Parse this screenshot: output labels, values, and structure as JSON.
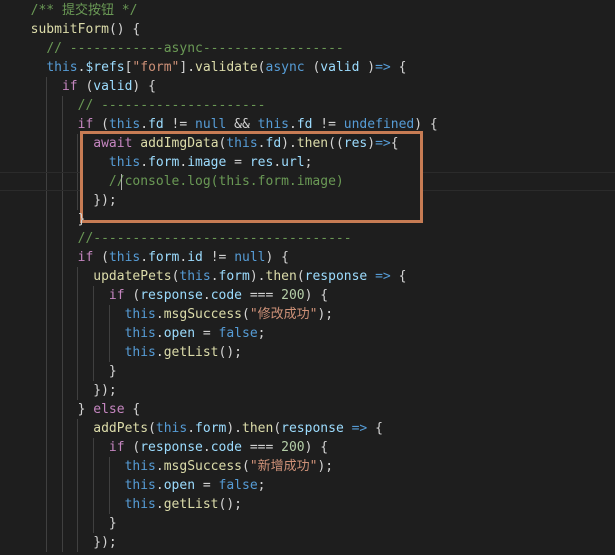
{
  "editor": {
    "lines": [
      [
        "  ",
        [
          "cm",
          "/** 提交按钮 */"
        ]
      ],
      [
        "  ",
        [
          "fn",
          "submitForm"
        ],
        [
          "pu",
          "() {"
        ]
      ],
      [
        "    ",
        [
          "cm",
          "// ------------async------------------"
        ]
      ],
      [
        "    ",
        [
          "sk",
          "this"
        ],
        [
          "pu",
          "."
        ],
        [
          "vr",
          "$refs"
        ],
        [
          "pu",
          "["
        ],
        [
          "st",
          "\"form\""
        ],
        [
          "pu",
          "]."
        ],
        [
          "fn",
          "validate"
        ],
        [
          "pu",
          "("
        ],
        [
          "sk",
          "async"
        ],
        [
          "pu",
          " ("
        ],
        [
          "vr",
          "valid"
        ],
        [
          "pu",
          " )"
        ],
        [
          "sk",
          "=>"
        ],
        [
          "pu",
          " {"
        ]
      ],
      [
        "      ",
        [
          "kw",
          "if"
        ],
        [
          "pu",
          " ("
        ],
        [
          "vr",
          "valid"
        ],
        [
          "pu",
          ") {"
        ]
      ],
      [
        "        ",
        [
          "cm",
          "// ---------------------"
        ]
      ],
      [
        "        ",
        [
          "kw",
          "if"
        ],
        [
          "pu",
          " ("
        ],
        [
          "sk",
          "this"
        ],
        [
          "pu",
          "."
        ],
        [
          "vr",
          "fd"
        ],
        [
          "pu",
          " != "
        ],
        [
          "sk",
          "null"
        ],
        [
          "pu",
          " && "
        ],
        [
          "sk",
          "this"
        ],
        [
          "pu",
          "."
        ],
        [
          "vr",
          "fd"
        ],
        [
          "pu",
          " != "
        ],
        [
          "sk",
          "undefined"
        ],
        [
          "pu",
          ") {"
        ]
      ],
      [
        "          ",
        [
          "kw",
          "await"
        ],
        [
          "pu",
          " "
        ],
        [
          "fn",
          "addImgData"
        ],
        [
          "pu",
          "("
        ],
        [
          "sk",
          "this"
        ],
        [
          "pu",
          "."
        ],
        [
          "vr",
          "fd"
        ],
        [
          "pu",
          ")."
        ],
        [
          "fn",
          "then"
        ],
        [
          "pu",
          "(("
        ],
        [
          "vr",
          "res"
        ],
        [
          "pu",
          ")"
        ],
        [
          "sk",
          "=>"
        ],
        [
          "pu",
          "{"
        ]
      ],
      [
        "            ",
        [
          "sk",
          "this"
        ],
        [
          "pu",
          "."
        ],
        [
          "vr",
          "form"
        ],
        [
          "pu",
          "."
        ],
        [
          "vr",
          "image"
        ],
        [
          "pu",
          " = "
        ],
        [
          "vr",
          "res"
        ],
        [
          "pu",
          "."
        ],
        [
          "vr",
          "url"
        ],
        [
          "pu",
          ";"
        ]
      ],
      [
        "            ",
        [
          "cm",
          "//console.log(this.form.image)"
        ]
      ],
      [
        "          ",
        [
          "pu",
          "});"
        ]
      ],
      [
        "        ",
        [
          "pu",
          "}"
        ]
      ],
      [
        "        ",
        [
          "cm",
          "//---------------------------------"
        ]
      ],
      [
        "        ",
        [
          "kw",
          "if"
        ],
        [
          "pu",
          " ("
        ],
        [
          "sk",
          "this"
        ],
        [
          "pu",
          "."
        ],
        [
          "vr",
          "form"
        ],
        [
          "pu",
          "."
        ],
        [
          "vr",
          "id"
        ],
        [
          "pu",
          " != "
        ],
        [
          "sk",
          "null"
        ],
        [
          "pu",
          ") {"
        ]
      ],
      [
        "          ",
        [
          "fn",
          "updatePets"
        ],
        [
          "pu",
          "("
        ],
        [
          "sk",
          "this"
        ],
        [
          "pu",
          "."
        ],
        [
          "vr",
          "form"
        ],
        [
          "pu",
          ")."
        ],
        [
          "fn",
          "then"
        ],
        [
          "pu",
          "("
        ],
        [
          "vr",
          "response"
        ],
        [
          "pu",
          " "
        ],
        [
          "sk",
          "=>"
        ],
        [
          "pu",
          " {"
        ]
      ],
      [
        "            ",
        [
          "kw",
          "if"
        ],
        [
          "pu",
          " ("
        ],
        [
          "vr",
          "response"
        ],
        [
          "pu",
          "."
        ],
        [
          "vr",
          "code"
        ],
        [
          "pu",
          " === "
        ],
        [
          "nm",
          "200"
        ],
        [
          "pu",
          ") {"
        ]
      ],
      [
        "              ",
        [
          "sk",
          "this"
        ],
        [
          "pu",
          "."
        ],
        [
          "fn",
          "msgSuccess"
        ],
        [
          "pu",
          "("
        ],
        [
          "st",
          "\"修改成功\""
        ],
        [
          "pu",
          ");"
        ]
      ],
      [
        "              ",
        [
          "sk",
          "this"
        ],
        [
          "pu",
          "."
        ],
        [
          "vr",
          "open"
        ],
        [
          "pu",
          " = "
        ],
        [
          "sk",
          "false"
        ],
        [
          "pu",
          ";"
        ]
      ],
      [
        "              ",
        [
          "sk",
          "this"
        ],
        [
          "pu",
          "."
        ],
        [
          "fn",
          "getList"
        ],
        [
          "pu",
          "();"
        ]
      ],
      [
        "            ",
        [
          "pu",
          "}"
        ]
      ],
      [
        "          ",
        [
          "pu",
          "});"
        ]
      ],
      [
        "        ",
        [
          "pu",
          "} "
        ],
        [
          "kw",
          "else"
        ],
        [
          "pu",
          " {"
        ]
      ],
      [
        "          ",
        [
          "fn",
          "addPets"
        ],
        [
          "pu",
          "("
        ],
        [
          "sk",
          "this"
        ],
        [
          "pu",
          "."
        ],
        [
          "vr",
          "form"
        ],
        [
          "pu",
          ")."
        ],
        [
          "fn",
          "then"
        ],
        [
          "pu",
          "("
        ],
        [
          "vr",
          "response"
        ],
        [
          "pu",
          " "
        ],
        [
          "sk",
          "=>"
        ],
        [
          "pu",
          " {"
        ]
      ],
      [
        "            ",
        [
          "kw",
          "if"
        ],
        [
          "pu",
          " ("
        ],
        [
          "vr",
          "response"
        ],
        [
          "pu",
          "."
        ],
        [
          "vr",
          "code"
        ],
        [
          "pu",
          " === "
        ],
        [
          "nm",
          "200"
        ],
        [
          "pu",
          ") {"
        ]
      ],
      [
        "              ",
        [
          "sk",
          "this"
        ],
        [
          "pu",
          "."
        ],
        [
          "fn",
          "msgSuccess"
        ],
        [
          "pu",
          "("
        ],
        [
          "st",
          "\"新增成功\""
        ],
        [
          "pu",
          ");"
        ]
      ],
      [
        "              ",
        [
          "sk",
          "this"
        ],
        [
          "pu",
          "."
        ],
        [
          "vr",
          "open"
        ],
        [
          "pu",
          " = "
        ],
        [
          "sk",
          "false"
        ],
        [
          "pu",
          ";"
        ]
      ],
      [
        "              ",
        [
          "sk",
          "this"
        ],
        [
          "pu",
          "."
        ],
        [
          "fn",
          "getList"
        ],
        [
          "pu",
          "();"
        ]
      ],
      [
        "            ",
        [
          "pu",
          "}"
        ]
      ],
      [
        "          ",
        [
          "pu",
          "});"
        ]
      ]
    ]
  }
}
